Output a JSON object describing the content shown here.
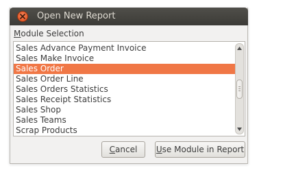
{
  "window": {
    "title": "Open New Report"
  },
  "section": {
    "mnemonic": "M",
    "rest": "odule Selection"
  },
  "list": {
    "items": [
      "Sales Advance Payment Invoice",
      "Sales Make Invoice",
      "Sales Order",
      "Sales Order Line",
      "Sales Orders Statistics",
      "Sales Receipt Statistics",
      "Sales Shop",
      "Sales Teams",
      "Scrap Products"
    ],
    "selected_index": 2,
    "scroll_fraction": 0.5
  },
  "buttons": {
    "cancel": {
      "mnemonic": "C",
      "rest": "ancel"
    },
    "use": {
      "mnemonic": "U",
      "rest": "se Module in Report"
    }
  },
  "colors": {
    "selection": "#f07746",
    "titlebar": "#3c3b37",
    "close": "#df4a16"
  },
  "icons": {
    "close": "close-icon",
    "scroll_up": "arrow-up-icon",
    "scroll_down": "arrow-down-icon"
  }
}
